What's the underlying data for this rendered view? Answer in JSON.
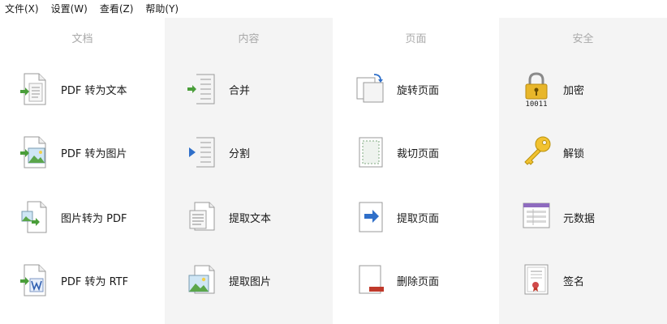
{
  "menubar": {
    "file": "文件(X)",
    "settings": "设置(W)",
    "view": "查看(Z)",
    "help": "帮助(Y)"
  },
  "columns": [
    {
      "header": "文档",
      "items": [
        {
          "label": "PDF 转为文本",
          "icon": "pdf-to-text-icon"
        },
        {
          "label": "PDF 转为图片",
          "icon": "pdf-to-image-icon"
        },
        {
          "label": "图片转为 PDF",
          "icon": "image-to-pdf-icon"
        },
        {
          "label": "PDF 转为 RTF",
          "icon": "pdf-to-rtf-icon"
        }
      ]
    },
    {
      "header": "内容",
      "items": [
        {
          "label": "合并",
          "icon": "merge-icon"
        },
        {
          "label": "分割",
          "icon": "split-icon"
        },
        {
          "label": "提取文本",
          "icon": "extract-text-icon"
        },
        {
          "label": "提取图片",
          "icon": "extract-image-icon"
        }
      ]
    },
    {
      "header": "页面",
      "items": [
        {
          "label": "旋转页面",
          "icon": "rotate-page-icon"
        },
        {
          "label": "裁切页面",
          "icon": "crop-page-icon"
        },
        {
          "label": "提取页面",
          "icon": "extract-page-icon"
        },
        {
          "label": "删除页面",
          "icon": "delete-page-icon"
        }
      ]
    },
    {
      "header": "安全",
      "items": [
        {
          "label": "加密",
          "icon": "lock-icon",
          "icon_caption": "10011"
        },
        {
          "label": "解锁",
          "icon": "key-icon"
        },
        {
          "label": "元数据",
          "icon": "metadata-icon"
        },
        {
          "label": "签名",
          "icon": "certificate-icon"
        }
      ]
    }
  ],
  "colors": {
    "header_text": "#a9a9a9",
    "column_shade": "#f4f4f4",
    "arrow_green": "#4a9e3a",
    "arrow_blue": "#2f6fc9",
    "delete_red": "#c0392b",
    "lock_gold": "#e8b62a",
    "metadata_purple": "#8e6bbf"
  }
}
